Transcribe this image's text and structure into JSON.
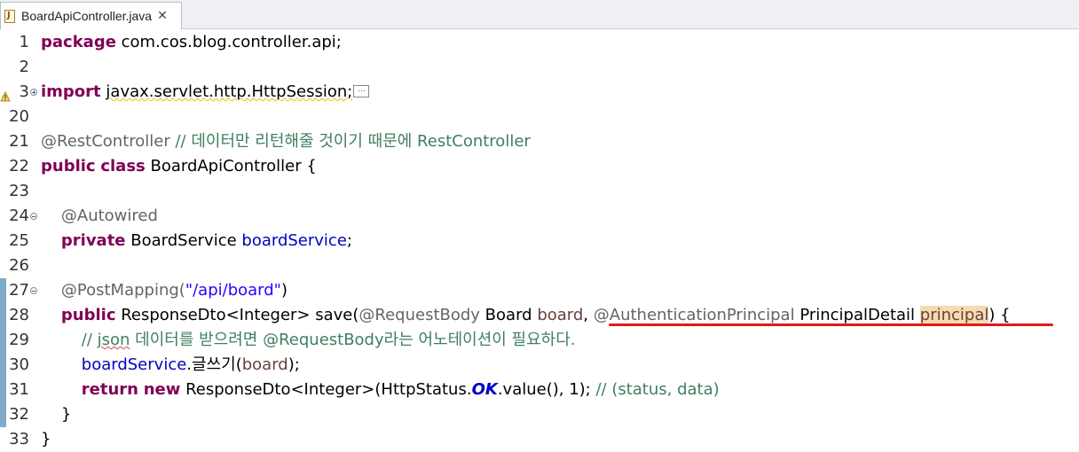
{
  "tab": {
    "label": "BoardApiController.java",
    "close": "✕"
  },
  "lines": [
    {
      "num": "1",
      "tokens": [
        {
          "t": "package",
          "c": "kw"
        },
        {
          "t": " com.cos.blog.controller.api;",
          "c": "plain"
        }
      ]
    },
    {
      "num": "2",
      "tokens": []
    },
    {
      "num": "3",
      "fold": "plus",
      "warn": true,
      "tokens": [
        {
          "t": "import",
          "c": "kw"
        },
        {
          "t": " ",
          "c": "plain"
        },
        {
          "t": "javax.servlet.http.HttpSession;",
          "c": "plain squiggle"
        }
      ],
      "collapsed": true
    },
    {
      "num": "20",
      "tokens": []
    },
    {
      "num": "21",
      "tokens": [
        {
          "t": "@RestController",
          "c": "ann"
        },
        {
          "t": " // 데이터만 리턴해줄 것이기 때문에 RestController",
          "c": "cmt"
        }
      ]
    },
    {
      "num": "22",
      "tokens": [
        {
          "t": "public",
          "c": "kw"
        },
        {
          "t": " ",
          "c": "plain"
        },
        {
          "t": "class",
          "c": "kw"
        },
        {
          "t": " BoardApiController {",
          "c": "plain"
        }
      ]
    },
    {
      "num": "23",
      "tokens": []
    },
    {
      "num": "24",
      "fold": "minus",
      "tokens": [
        {
          "t": "    @Autowired",
          "c": "ann"
        }
      ]
    },
    {
      "num": "25",
      "tokens": [
        {
          "t": "    ",
          "c": "plain"
        },
        {
          "t": "private",
          "c": "kw"
        },
        {
          "t": " BoardService ",
          "c": "plain"
        },
        {
          "t": "boardService",
          "c": "fld"
        },
        {
          "t": ";",
          "c": "plain"
        }
      ]
    },
    {
      "num": "26",
      "tokens": []
    },
    {
      "num": "27",
      "fold": "minus",
      "tokens": [
        {
          "t": "    @PostMapping(",
          "c": "ann"
        },
        {
          "t": "\"/api/board\"",
          "c": "str"
        },
        {
          "t": ")",
          "c": "plain"
        }
      ]
    },
    {
      "num": "28",
      "tokens": [
        {
          "t": "    ",
          "c": "plain"
        },
        {
          "t": "public",
          "c": "kw"
        },
        {
          "t": " ResponseDto<Integer> save(",
          "c": "plain"
        },
        {
          "t": "@RequestBody",
          "c": "ann"
        },
        {
          "t": " Board ",
          "c": "plain"
        },
        {
          "t": "board",
          "c": "prm"
        },
        {
          "t": ", ",
          "c": "plain"
        },
        {
          "t": "@AuthenticationPrincipal",
          "c": "ann"
        },
        {
          "t": " PrincipalDetail ",
          "c": "plain"
        },
        {
          "t": "principal",
          "c": "prm highlight"
        },
        {
          "t": ") {",
          "c": "plain"
        }
      ]
    },
    {
      "num": "29",
      "tokens": [
        {
          "t": "        // ",
          "c": "cmt"
        },
        {
          "t": "json",
          "c": "cmt squiggle-red"
        },
        {
          "t": " 데이터를 받으려면 @RequestBody라는 어노테이션이 필요하다.",
          "c": "cmt"
        }
      ]
    },
    {
      "num": "30",
      "tokens": [
        {
          "t": "        ",
          "c": "plain"
        },
        {
          "t": "boardService",
          "c": "fld"
        },
        {
          "t": ".글쓰기(",
          "c": "plain"
        },
        {
          "t": "board",
          "c": "prm"
        },
        {
          "t": ");",
          "c": "plain"
        }
      ]
    },
    {
      "num": "31",
      "tokens": [
        {
          "t": "        ",
          "c": "plain"
        },
        {
          "t": "return",
          "c": "kw"
        },
        {
          "t": " ",
          "c": "plain"
        },
        {
          "t": "new",
          "c": "kw"
        },
        {
          "t": " ResponseDto<Integer>(HttpStatus.",
          "c": "plain"
        },
        {
          "t": "OK",
          "c": "cst"
        },
        {
          "t": ".value(), 1); ",
          "c": "plain"
        },
        {
          "t": "// (status, data)",
          "c": "cmt"
        }
      ]
    },
    {
      "num": "32",
      "tokens": [
        {
          "t": "    }",
          "c": "plain"
        }
      ]
    },
    {
      "num": "33",
      "tokens": [
        {
          "t": "}",
          "c": "plain"
        }
      ]
    }
  ]
}
